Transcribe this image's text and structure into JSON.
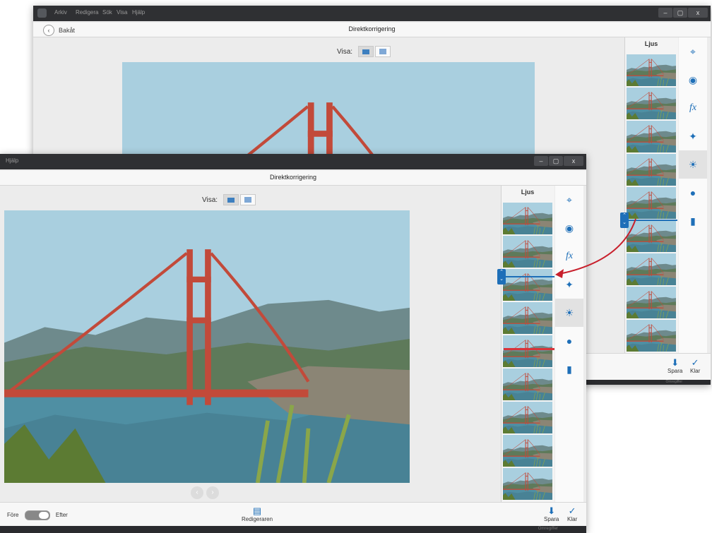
{
  "back_window": {
    "menu": [
      "Arkiv",
      "Redigera",
      "Sök",
      "Visa",
      "Hjälp"
    ],
    "window_buttons": [
      "–",
      "▢",
      "x"
    ],
    "back_label": "Bakåt",
    "title": "Direktkorrigering",
    "visa_label": "Visa:",
    "panel_title": "Ljus",
    "save_label": "Spara",
    "done_label": "Klar",
    "status_text": "Omregiffer"
  },
  "front_window": {
    "menu": [
      "Hjälp"
    ],
    "window_buttons": [
      "–",
      "▢",
      "x"
    ],
    "title": "Direktkorrigering",
    "visa_label": "Visa:",
    "panel_title": "Ljus",
    "before_label": "Före",
    "after_label": "Efter",
    "editor_label": "Redigeraren",
    "save_label": "Spara",
    "done_label": "Klar",
    "status_text": "Omregiffer"
  },
  "tools": [
    "crop-icon",
    "redeye-icon",
    "fx-icon",
    "magic-wand-icon",
    "light-icon",
    "color-icon",
    "balance-icon"
  ],
  "colors": {
    "accent": "#1e6fb8",
    "arrow": "#c8202c",
    "titlebar": "#2f3033"
  }
}
